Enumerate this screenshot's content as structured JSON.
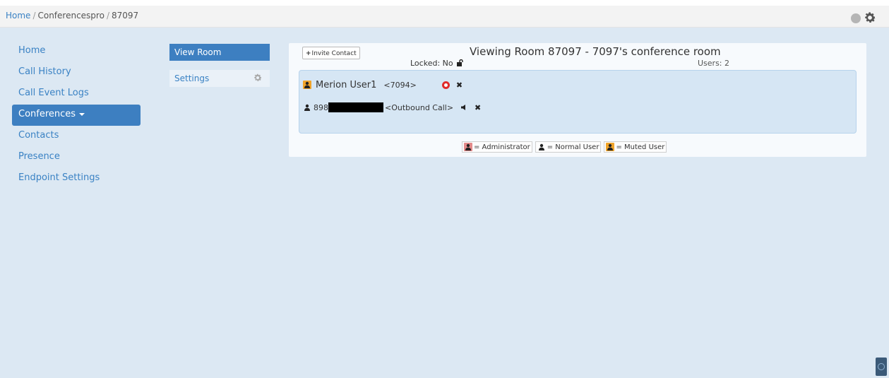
{
  "breadcrumb": {
    "home": "Home",
    "conferences": "Conferencespro",
    "room": "87097",
    "separator": "/"
  },
  "nav": {
    "items": [
      {
        "label": "Home"
      },
      {
        "label": "Call History"
      },
      {
        "label": "Call Event Logs"
      },
      {
        "label": "Conferences",
        "active": true
      },
      {
        "label": "Contacts"
      },
      {
        "label": "Presence"
      },
      {
        "label": "Endpoint Settings"
      }
    ]
  },
  "subnav": {
    "view_room": "View Room",
    "settings": "Settings"
  },
  "room": {
    "invite_label": "Invite Contact",
    "title": "Viewing Room 87097 - 7097's conference room",
    "locked_label": "Locked: No",
    "users_label": "Users: 2",
    "participants": [
      {
        "name": "Merion User1",
        "extension": "<7094>",
        "role": "muted"
      },
      {
        "name": "898",
        "extension": "<Outbound Call>",
        "role": "normal"
      }
    ]
  },
  "legend": {
    "administrator": "= Administrator",
    "normal": "= Normal User",
    "muted": "= Muted User"
  },
  "icons": {
    "status": "status-dot-icon",
    "gear": "gear-icon",
    "lock": "unlock-icon",
    "user": "user-icon",
    "remove": "close-icon",
    "admin": "admin-icon",
    "speaker": "speaker-icon"
  },
  "colors": {
    "accent": "#3d7fc1",
    "muted": "#f0a42a",
    "admin": "#e38a8a"
  }
}
